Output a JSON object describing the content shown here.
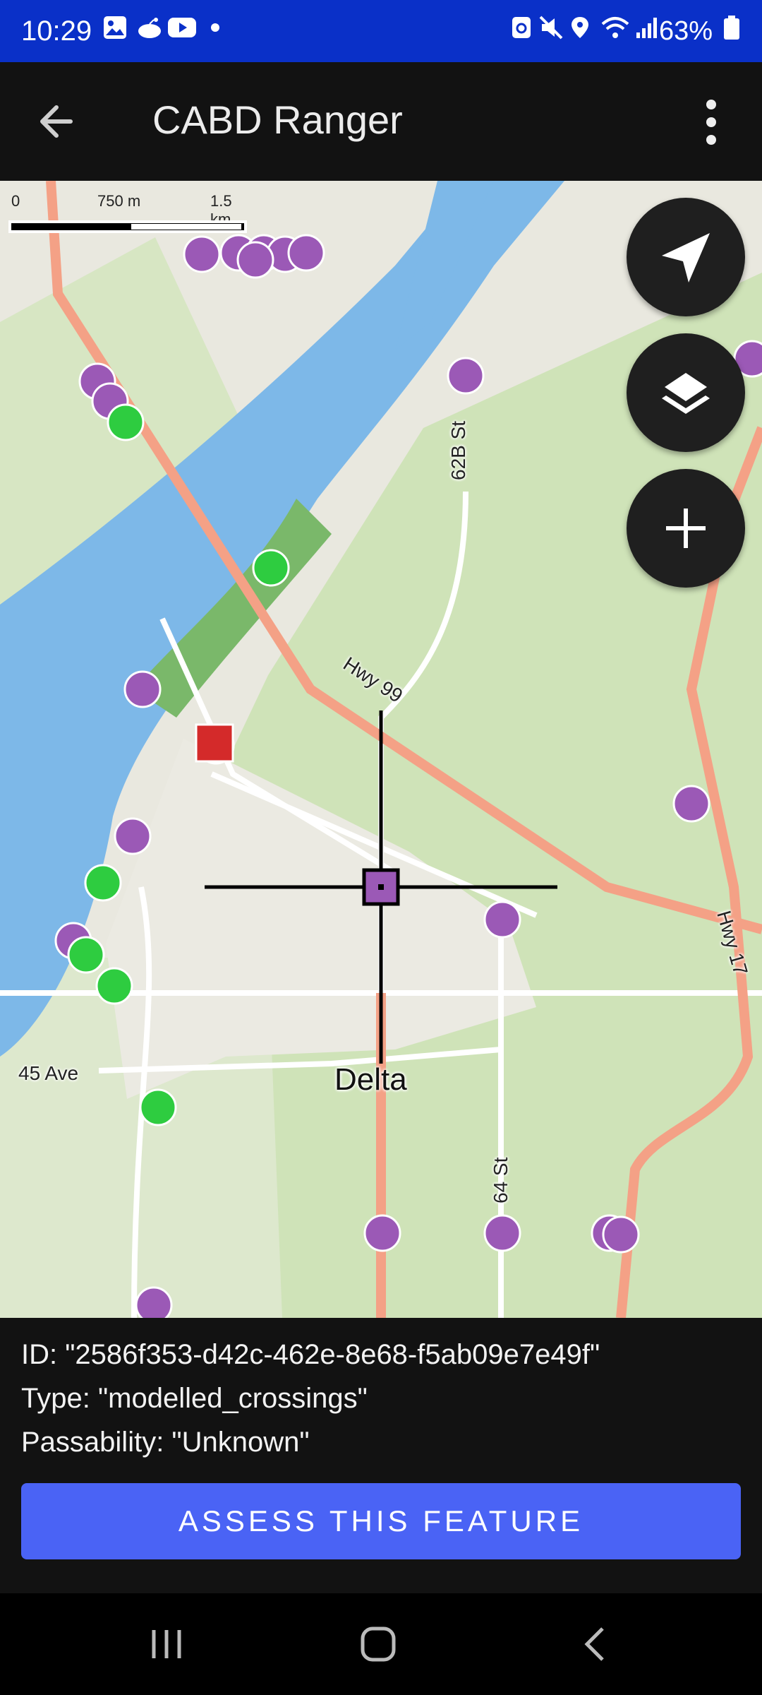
{
  "status_bar": {
    "time": "10:29",
    "battery_pct": "63%",
    "icons": [
      "gallery-icon",
      "reddit-icon",
      "youtube-icon",
      "dot-icon",
      "recycle-icon",
      "mute-icon",
      "location-icon",
      "wifi-icon",
      "signal-icon",
      "battery-icon"
    ]
  },
  "app_bar": {
    "title": "CABD Ranger",
    "back_icon": "arrow-back-icon",
    "menu_icon": "more-vert-icon"
  },
  "map": {
    "scale": {
      "start": "0",
      "mid": "750 m",
      "end": "1.5 km"
    },
    "labels": {
      "town": "Delta",
      "road_62b": "62B St",
      "road_hwy99": "Hwy 99",
      "road_hwy17": "Hwy 17",
      "road_45ave": "45 Ave",
      "road_64st": "64 St"
    },
    "controls": [
      "navigation-icon",
      "layers-icon",
      "plus-icon"
    ],
    "marker_colors": {
      "purple": "#9b59b6",
      "green": "#2ecc40",
      "red": "#d42a2a"
    }
  },
  "feature": {
    "id_line": "ID: \"2586f353-d42c-462e-8e68-f5ab09e7e49f\"",
    "type_line": "Type: \"modelled_crossings\"",
    "passability_line": "Passability: \"Unknown\"",
    "button_label": "ASSESS THIS FEATURE"
  },
  "nav_bar": {
    "icons": [
      "recents-icon",
      "home-icon",
      "back-nav-icon"
    ]
  }
}
